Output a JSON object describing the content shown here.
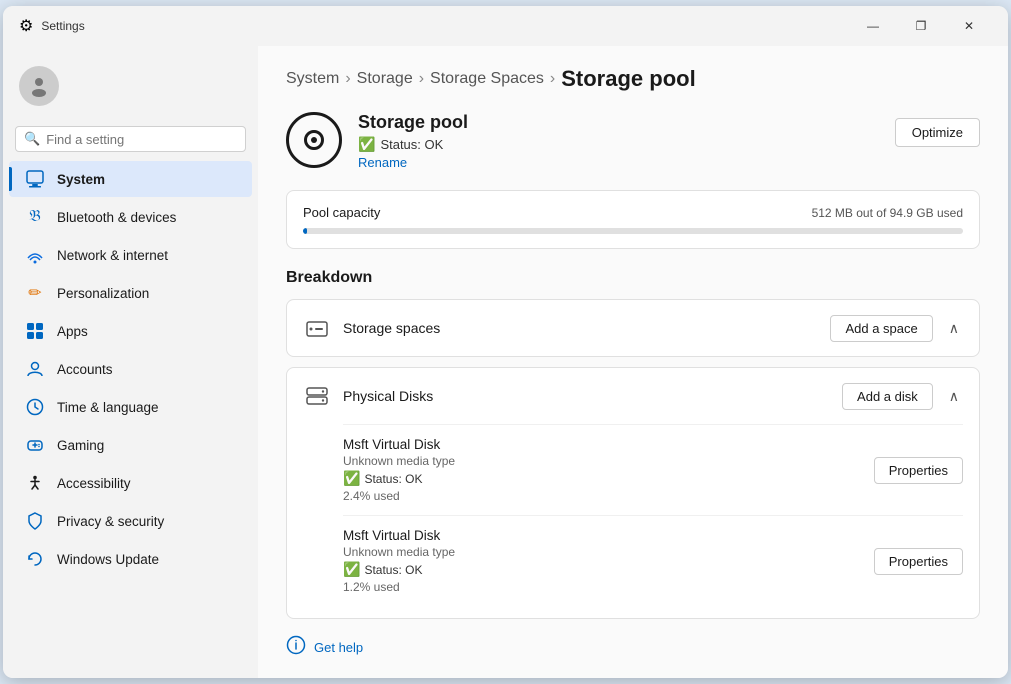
{
  "window": {
    "title": "Settings",
    "controls": {
      "minimize": "—",
      "maximize": "❐",
      "close": "✕"
    }
  },
  "sidebar": {
    "search_placeholder": "Find a setting",
    "nav_items": [
      {
        "id": "system",
        "label": "System",
        "active": true
      },
      {
        "id": "bluetooth",
        "label": "Bluetooth & devices"
      },
      {
        "id": "network",
        "label": "Network & internet"
      },
      {
        "id": "personalization",
        "label": "Personalization"
      },
      {
        "id": "apps",
        "label": "Apps"
      },
      {
        "id": "accounts",
        "label": "Accounts"
      },
      {
        "id": "time",
        "label": "Time & language"
      },
      {
        "id": "gaming",
        "label": "Gaming"
      },
      {
        "id": "accessibility",
        "label": "Accessibility"
      },
      {
        "id": "privacy",
        "label": "Privacy & security"
      },
      {
        "id": "update",
        "label": "Windows Update"
      }
    ]
  },
  "breadcrumb": {
    "items": [
      "System",
      "Storage",
      "Storage Spaces"
    ],
    "current": "Storage pool"
  },
  "header": {
    "title": "Storage pool",
    "status_label": "Status: OK",
    "rename_label": "Rename",
    "optimize_label": "Optimize"
  },
  "capacity": {
    "label": "Pool capacity",
    "value": "512 MB out of 94.9 GB used",
    "percent": 0.6
  },
  "breakdown": {
    "title": "Breakdown",
    "sections": [
      {
        "id": "spaces",
        "label": "Storage spaces",
        "action": "Add a space"
      },
      {
        "id": "disks",
        "label": "Physical Disks",
        "action": "Add a disk",
        "disks": [
          {
            "name": "Msft Virtual Disk",
            "media_type": "Unknown media type",
            "status": "Status: OK",
            "usage": "2.4% used"
          },
          {
            "name": "Msft Virtual Disk",
            "media_type": "Unknown media type",
            "status": "Status: OK",
            "usage": "1.2% used"
          }
        ]
      }
    ]
  },
  "help": {
    "label": "Get help"
  }
}
